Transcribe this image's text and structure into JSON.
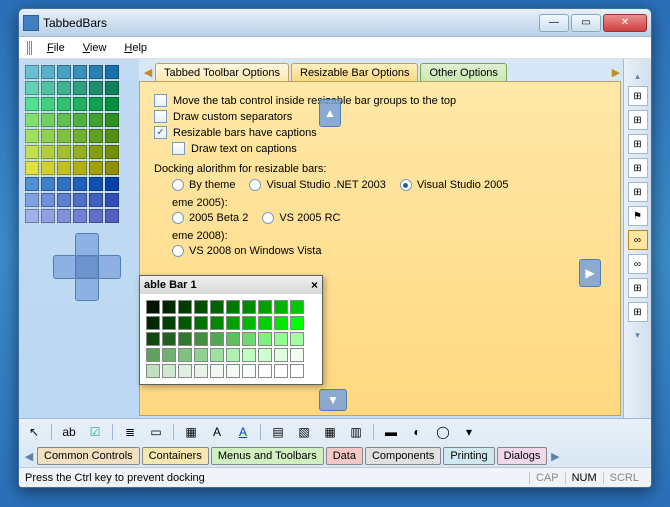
{
  "window": {
    "title": "TabbedBars"
  },
  "menu": {
    "file": "File",
    "view": "View",
    "help": "Help"
  },
  "tabs": {
    "t1": "Tabbed Toolbar Options",
    "t2": "Resizable Bar Options",
    "t3": "Other Options"
  },
  "opts": {
    "move_top": "Move the tab control inside resizable bar groups to the top",
    "draw_sep": "Draw custom separators",
    "have_cap": "Resizable bars have captions",
    "draw_text": "Draw text on captions",
    "group1": "Docking alorithm for resizable bars:",
    "r_theme": "By theme",
    "r_vs2003": "Visual Studio .NET 2003",
    "r_vs2005": "Visual Studio 2005",
    "group2": "eme 2005):",
    "r_beta2": "2005 Beta 2",
    "r_rc": "VS 2005 RC",
    "group3": "eme 2008):",
    "r_vista": "VS 2008 on Windows Vista"
  },
  "floatbar": {
    "title": "able Bar 1"
  },
  "bottomtabs": {
    "t1": "Common Controls",
    "t2": "Containers",
    "t3": "Menus and Toolbars",
    "t4": "Data",
    "t5": "Components",
    "t6": "Printing",
    "t7": "Dialogs"
  },
  "status": {
    "msg": "Press the Ctrl key to prevent docking",
    "cap": "CAP",
    "num": "NUM",
    "scrl": "SCRL"
  },
  "colors": {
    "left_grid": [
      [
        "#6ac0d0",
        "#5ab0c8",
        "#4aa0c0",
        "#3a90b8",
        "#2a80b0",
        "#1a70a8"
      ],
      [
        "#60d0b0",
        "#50c0a0",
        "#40b090",
        "#30a080",
        "#209070",
        "#108060"
      ],
      [
        "#50e090",
        "#40d080",
        "#30c070",
        "#20b060",
        "#10a050",
        "#009040"
      ],
      [
        "#80e070",
        "#70d060",
        "#60c050",
        "#50b040",
        "#40a030",
        "#309020"
      ],
      [
        "#a0e060",
        "#90d050",
        "#80c040",
        "#70b030",
        "#60a020",
        "#509010"
      ],
      [
        "#c0e050",
        "#b0d040",
        "#a0c030",
        "#90b020",
        "#80a010",
        "#709000"
      ],
      [
        "#e0e040",
        "#d0d030",
        "#c0c020",
        "#b0b010",
        "#a0a000",
        "#909000"
      ],
      [
        "#5090d0",
        "#4080c8",
        "#3070c0",
        "#2060b8",
        "#1050b0",
        "#0040a8"
      ],
      [
        "#80a0e0",
        "#7090d8",
        "#6080d0",
        "#5070c8",
        "#4060c0",
        "#3050b8"
      ],
      [
        "#a0b0e8",
        "#90a0e0",
        "#8090d8",
        "#7080d0",
        "#6070c8",
        "#5060c0"
      ]
    ],
    "green_grid": [
      [
        "#001400",
        "#002800",
        "#003c00",
        "#005000",
        "#006400",
        "#007800",
        "#008c00",
        "#00a000",
        "#00b400",
        "#00c800"
      ],
      [
        "#002800",
        "#004000",
        "#005800",
        "#007000",
        "#008800",
        "#00a000",
        "#00b800",
        "#00d000",
        "#00e800",
        "#00ff00"
      ],
      [
        "#104810",
        "#206020",
        "#307830",
        "#409040",
        "#50a850",
        "#60c060",
        "#70d870",
        "#80f080",
        "#90ff90",
        "#a0ffa0"
      ],
      [
        "#60a060",
        "#70b070",
        "#80c080",
        "#90d090",
        "#a0e0a0",
        "#b0f0b0",
        "#c0ffc0",
        "#d0ffd0",
        "#e0ffe0",
        "#f0fff0"
      ],
      [
        "#c0e0c0",
        "#d0e8d0",
        "#e0f0e0",
        "#e8f4e8",
        "#f0f8f0",
        "#f4faf4",
        "#f8fcf8",
        "#fcfefc",
        "#fefffe",
        "#ffffff"
      ]
    ]
  },
  "right_icons": [
    "⊞",
    "⊞",
    "⊞",
    "⊞",
    "⊞",
    "⚑",
    "∞",
    "∞",
    "⊞",
    "⊞"
  ]
}
